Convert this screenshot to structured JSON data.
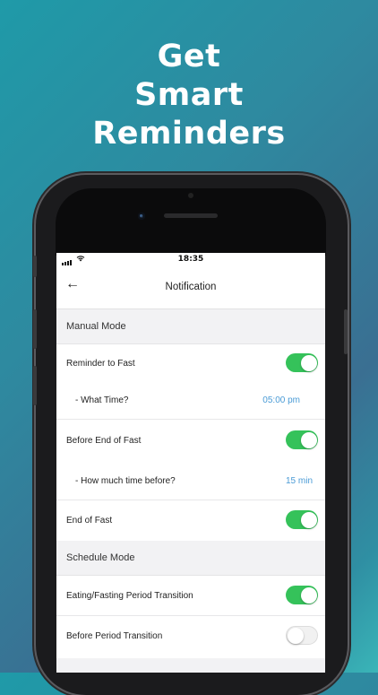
{
  "headline": {
    "line1": "Get",
    "line2": "Smart",
    "line3": "Reminders"
  },
  "status_bar": {
    "time": "18:35",
    "signal_icon": "signal-bars-icon",
    "wifi_icon": "wifi-icon"
  },
  "nav": {
    "back_icon": "arrow-left-icon",
    "back_glyph": "←",
    "title": "Notification"
  },
  "sections": {
    "manual": "Manual Mode",
    "schedule": "Schedule Mode"
  },
  "rows": {
    "reminder_to_fast": {
      "label": "Reminder to Fast",
      "enabled": true
    },
    "what_time": {
      "label": "- What Time?",
      "value": "05:00 pm"
    },
    "before_end": {
      "label": "Before End of Fast",
      "enabled": true
    },
    "how_much_time": {
      "label": "- How much time before?",
      "value": "15 min"
    },
    "end_of_fast": {
      "label": "End of Fast",
      "enabled": true
    },
    "eating_fasting": {
      "label": "Eating/Fasting Period Transition",
      "enabled": true
    },
    "before_period": {
      "label": "Before Period Transition",
      "enabled": false
    }
  },
  "colors": {
    "toggle_on": "#35c25a",
    "value_text": "#4a9bd6"
  }
}
